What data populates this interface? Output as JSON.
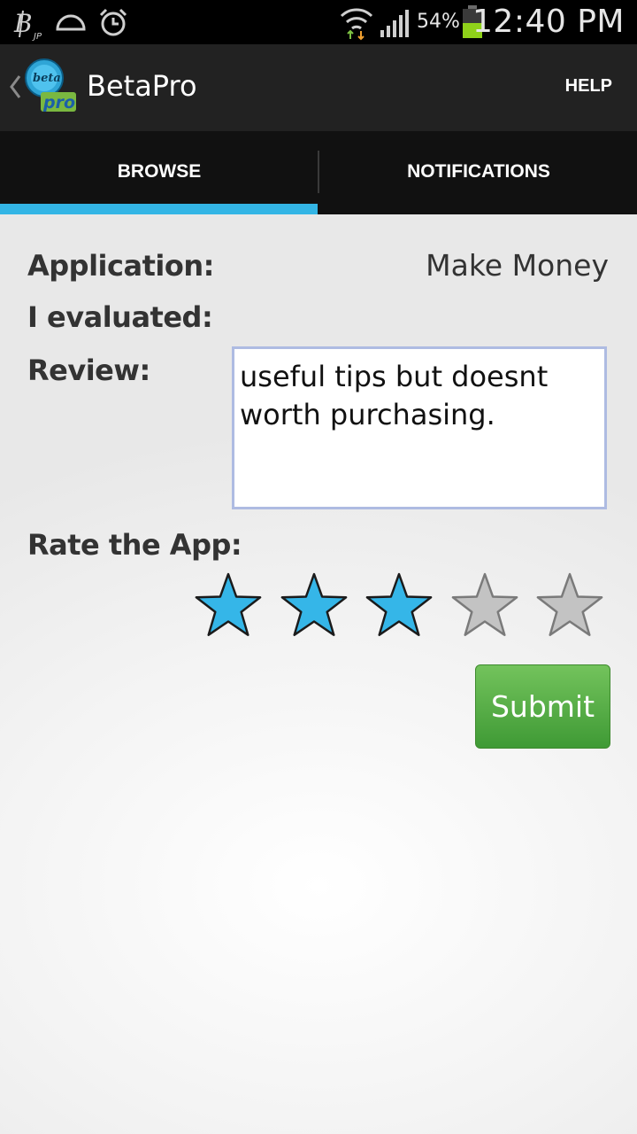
{
  "status_bar": {
    "battery_percent": "54%",
    "time": "12:40 PM",
    "icons": [
      "bitcoin-jp-icon",
      "cloud-icon",
      "alarm-clock-icon",
      "wifi-icon",
      "signal-icon",
      "battery-icon"
    ]
  },
  "action_bar": {
    "title": "BetaPro",
    "help_label": "HELP",
    "logo_top_text": "beta",
    "logo_bottom_text": "pro"
  },
  "tabs": [
    {
      "label": "BROWSE",
      "selected": true
    },
    {
      "label": "NOTIFICATIONS",
      "selected": false
    }
  ],
  "form": {
    "application_label": "Application:",
    "application_value": "Make Money",
    "evaluated_label": "I evaluated:",
    "review_label": "Review:",
    "review_text": "useful tips but doesnt\nworth purchasing.",
    "rate_label": "Rate the App:",
    "rating": 3,
    "rating_max": 5,
    "submit_label": "Submit"
  },
  "colors": {
    "accent": "#33b5e5",
    "star_filled": "#35b6e8",
    "star_empty": "#c3c3c3",
    "submit": "#4caf3f"
  }
}
